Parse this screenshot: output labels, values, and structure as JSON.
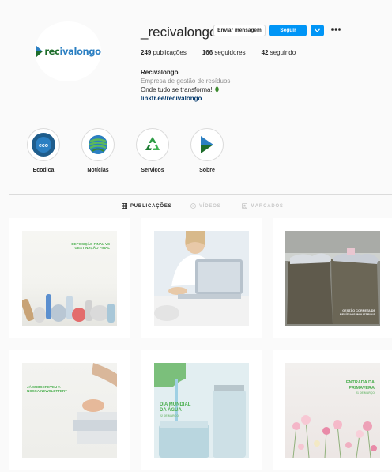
{
  "profile": {
    "username": "_recivalongo",
    "logo": {
      "part1": "rec",
      "part2": "ivalongo"
    },
    "buttons": {
      "message": "Enviar mensagem",
      "follow": "Seguir"
    },
    "stats": [
      {
        "value": "249",
        "label": " publicações"
      },
      {
        "value": "166",
        "label": " seguidores"
      },
      {
        "value": "42",
        "label": " seguindo"
      }
    ],
    "bio": {
      "name": "Recivalongo",
      "category": "Empresa de gestão de resíduos",
      "tagline": "Onde tudo se transforma!",
      "link": "linktr.ee/recivalongo"
    }
  },
  "highlights": [
    {
      "label": "Ecodica",
      "icon_text": "eco"
    },
    {
      "label": "Notícias"
    },
    {
      "label": "Serviços"
    },
    {
      "label": "Sobre"
    }
  ],
  "tabs": [
    {
      "label": "PUBLICAÇÕES",
      "active": true
    },
    {
      "label": "VÍDEOS",
      "active": false
    },
    {
      "label": "MARCADOS",
      "active": false
    }
  ],
  "posts": [
    {
      "line1": "DEPOSIÇÃO FINAL VS",
      "line2": "GESTINAÇÃO FINAL"
    },
    {},
    {
      "line1": "GESTÃO CORRETA DE",
      "line2": "RESÍDUOS INDUSTRIAIS"
    },
    {
      "line1": "JÁ SUBSCREVEU A",
      "line2": "NOSSA NEWSLETTER?"
    },
    {
      "line1": "DIA MUNDIAL",
      "line2": "DA ÁGUA",
      "line3": "22 DE MARÇO"
    },
    {
      "line1": "ENTRADA DA",
      "line2": "PRIMAVERA",
      "line3": "21 DE MARÇO"
    }
  ],
  "colors": {
    "brand_green": "#1e6d2b",
    "brand_blue": "#2b7fc2",
    "follow_blue": "#0095f6"
  }
}
